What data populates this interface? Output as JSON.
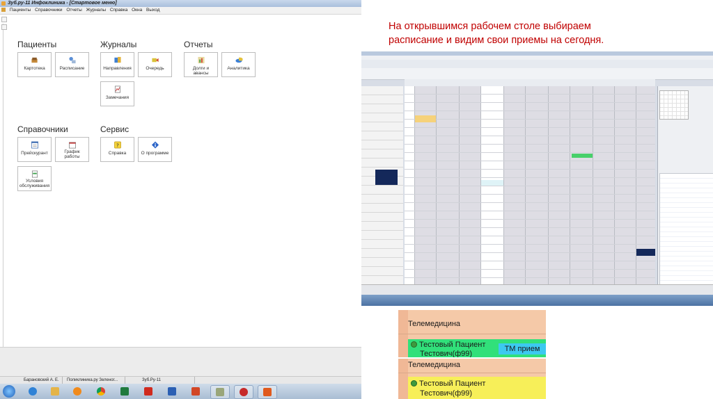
{
  "window": {
    "title": "Зуб.ру-11 Инфоклиника - [Стартовое меню]",
    "menu": [
      "Пациенты",
      "Справочники",
      "Отчеты",
      "Журналы",
      "Справка",
      "Окна",
      "Выход"
    ]
  },
  "groups": {
    "patients": {
      "title": "Пациенты",
      "tiles": [
        "Картотека",
        "Расписание"
      ]
    },
    "journals": {
      "title": "Журналы",
      "tiles": [
        "Направления",
        "Очередь",
        "Замечания"
      ]
    },
    "reports": {
      "title": "Отчеты",
      "tiles": [
        "Долги и авансы",
        "Аналитика"
      ]
    },
    "directories": {
      "title": "Справочники",
      "tiles": [
        "Прейскурант",
        "График работы",
        "Условия обслуживания"
      ]
    },
    "service": {
      "title": "Сервис",
      "tiles": [
        "Справка",
        "О программе"
      ]
    }
  },
  "statusbar": {
    "user": "Барановский А. Е.",
    "clinic": "Поликлиника.ру Зеленог...",
    "version": "Зуб.Ру-11"
  },
  "taskbar": {
    "icons": [
      "start-orb",
      "ie",
      "explorer",
      "media-player",
      "chrome",
      "excel",
      "acrobat",
      "word",
      "powerpoint",
      "app-tool",
      "app-red",
      "app-star"
    ]
  },
  "caption": {
    "line1": "На открывшимся рабочем столе выбираем",
    "line2": "расписание и видим свои приемы на сегодня."
  },
  "zoom": {
    "crop1": {
      "header": "Телемедицина",
      "patient_line1": "Тестовый Пациент",
      "patient_line2": "Тестович(ф99)",
      "badge": "ТМ прием"
    },
    "crop2": {
      "header": "Телемедицина",
      "patient_line1": "Тестовый Пациент",
      "patient_line2": "Тестович(ф99)"
    }
  },
  "colors": {
    "caption": "#c00000",
    "crop_bg": "#f5c9a8",
    "appointment_green": "#31e07a",
    "appointment_yellow": "#f7ef59",
    "badge_cyan": "#3cc9f0",
    "selection": "#14285a"
  }
}
